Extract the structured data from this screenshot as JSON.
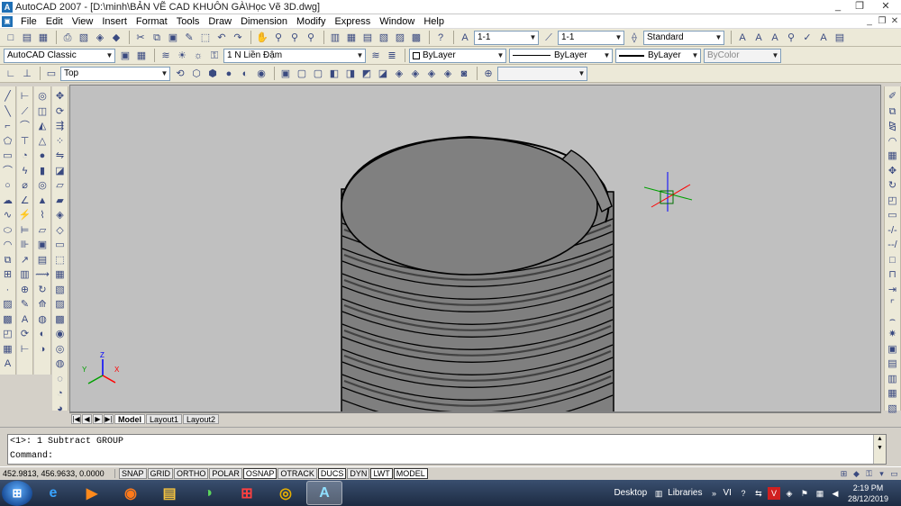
{
  "window": {
    "title": "AutoCAD 2007 - [D:\\minh\\BẢN VẼ CAD KHUÔN GÀ\\Học Vẽ  3D.dwg]",
    "controls": [
      "_",
      "❐",
      "✕"
    ]
  },
  "menu": {
    "items": [
      "File",
      "Edit",
      "View",
      "Insert",
      "Format",
      "Tools",
      "Draw",
      "Dimension",
      "Modify",
      "Express",
      "Window",
      "Help"
    ],
    "doc_controls": [
      "_",
      "❐",
      "✕"
    ]
  },
  "toolbar1": {
    "dimstyle_value": "1-1",
    "mleaderstyle_value": "1-1",
    "textstyle_value": "Standard"
  },
  "toolbar2": {
    "workspace_value": "AutoCAD Classic",
    "layer_value": "1 N Liền Đậm",
    "color_value": "ByLayer",
    "linetype_value": "ByLayer",
    "lineweight_value": "ByLayer",
    "plotstyle_value": "ByColor"
  },
  "toolbar3": {
    "view_value": "Top"
  },
  "tabs": {
    "nav": [
      "|◀",
      "◀",
      "▶",
      "▶|"
    ],
    "items": [
      {
        "label": "Model",
        "active": true
      },
      {
        "label": "Layout1",
        "active": false
      },
      {
        "label": "Layout2",
        "active": false
      }
    ]
  },
  "command": {
    "history": "<1>: 1 Subtract GROUP",
    "prompt": "Command:",
    "input": ""
  },
  "status": {
    "coords": "452.9813, 456.9633, 0.0000",
    "toggles": [
      {
        "label": "SNAP",
        "on": false
      },
      {
        "label": "GRID",
        "on": false
      },
      {
        "label": "ORTHO",
        "on": false
      },
      {
        "label": "POLAR",
        "on": false
      },
      {
        "label": "OSNAP",
        "on": true
      },
      {
        "label": "OTRACK",
        "on": false
      },
      {
        "label": "DUCS",
        "on": true
      },
      {
        "label": "DYN",
        "on": false
      },
      {
        "label": "LWT",
        "on": true
      },
      {
        "label": "MODEL",
        "on": true
      }
    ]
  },
  "ucs": {
    "x": "X",
    "y": "Y",
    "z": "Z"
  },
  "taskbar": {
    "desktop_label": "Desktop",
    "libraries_label": "Libraries",
    "lang": "VI",
    "time": "2:19 PM",
    "date": "28/12/2019"
  },
  "colors": {
    "viewport_bg": "#c0c0c0",
    "model_face": "#7f7f7f",
    "edge": "#000000",
    "ucs_x": "#ff0000",
    "ucs_y": "#00a000",
    "ucs_z": "#0000ff"
  }
}
